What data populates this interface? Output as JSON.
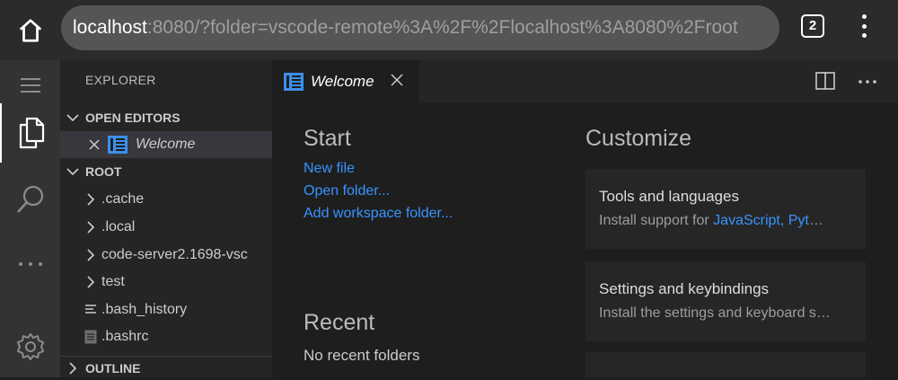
{
  "browser": {
    "url_host": "localhost",
    "url_rest": ":8080/?folder=vscode-remote%3A%2F%2Flocalhost%3A8080%2Froot",
    "tab_count": "2",
    "icons": [
      "home-icon",
      "tabs-icon",
      "more-vert-icon"
    ]
  },
  "activity_bar": {
    "items": [
      "menu-icon",
      "files-icon",
      "search-icon",
      "more-icon",
      "gear-icon"
    ]
  },
  "sidebar": {
    "title": "EXPLORER",
    "open_editors_label": "OPEN EDITORS",
    "open_editors": [
      {
        "label": "Welcome"
      }
    ],
    "root_label": "ROOT",
    "files": [
      {
        "label": ".cache",
        "type": "folder"
      },
      {
        "label": ".local",
        "type": "folder"
      },
      {
        "label": "code-server2.1698-vsc",
        "type": "folder"
      },
      {
        "label": "test",
        "type": "folder"
      },
      {
        "label": ".bash_history",
        "type": "file"
      },
      {
        "label": ".bashrc",
        "type": "file"
      }
    ],
    "outline_label": "OUTLINE"
  },
  "editor_tab": {
    "label": "Welcome"
  },
  "welcome": {
    "start_heading": "Start",
    "links": [
      "New file",
      "Open folder...",
      "Add workspace folder..."
    ],
    "recent_heading": "Recent",
    "no_recent": "No recent folders",
    "customize_heading": "Customize",
    "cards": [
      {
        "title": "Tools and languages",
        "desc_prefix": "Install support for ",
        "desc_link": "JavaScript, Pyt",
        "desc_suffix": "…"
      },
      {
        "title": "Settings and keybindings",
        "desc_prefix": "Install the settings and keyboard s…",
        "desc_link": "",
        "desc_suffix": ""
      }
    ]
  },
  "colors": {
    "accent": "#3794ff",
    "welcome_icon": "#3b8eea"
  }
}
